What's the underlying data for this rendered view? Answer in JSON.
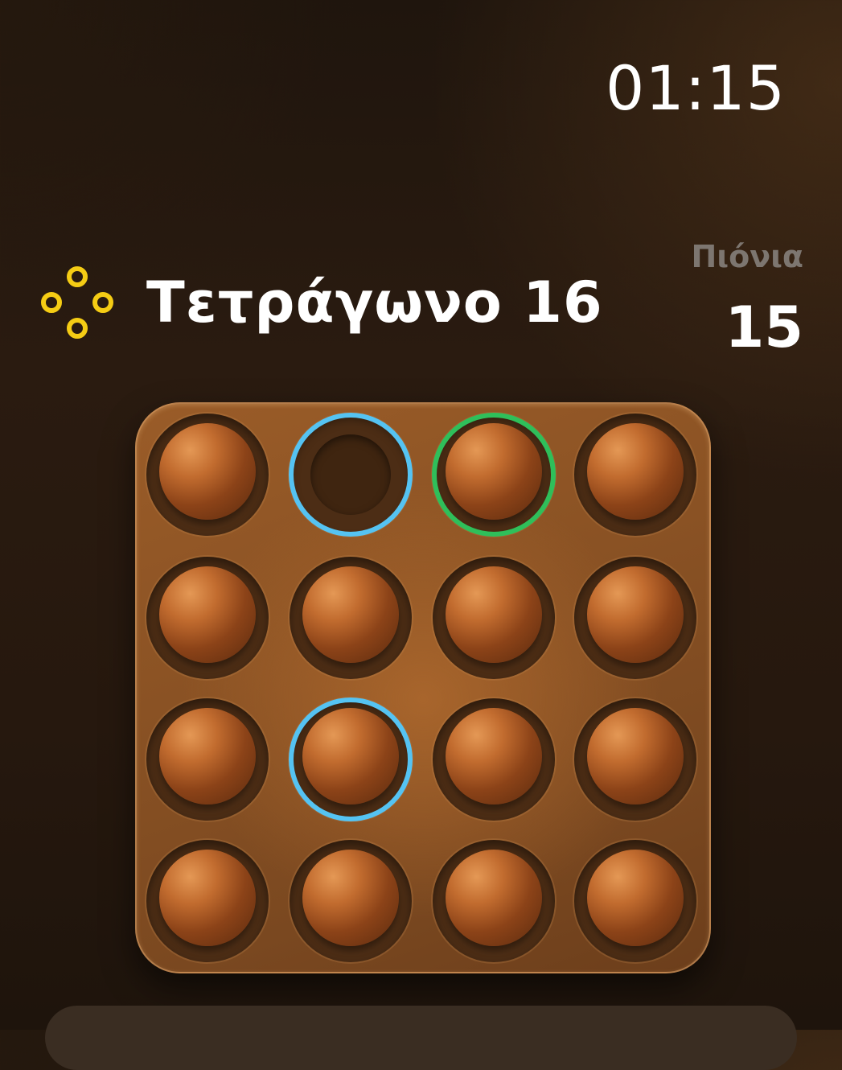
{
  "status": {
    "time": "01:15"
  },
  "header": {
    "icon": "four-rings-icon",
    "title": "Τετράγωνο 16",
    "accent_color": "#f5cc14"
  },
  "counter": {
    "label": "Πιόνια",
    "value": "15"
  },
  "board": {
    "rows": 4,
    "cols": 4,
    "cells": [
      [
        {
          "peg": true
        },
        {
          "peg": false,
          "highlight": "blue"
        },
        {
          "peg": true,
          "highlight": "green"
        },
        {
          "peg": true
        }
      ],
      [
        {
          "peg": true
        },
        {
          "peg": true
        },
        {
          "peg": true
        },
        {
          "peg": true
        }
      ],
      [
        {
          "peg": true
        },
        {
          "peg": true,
          "highlight": "blue"
        },
        {
          "peg": true
        },
        {
          "peg": true
        }
      ],
      [
        {
          "peg": true
        },
        {
          "peg": true
        },
        {
          "peg": true
        },
        {
          "peg": true
        }
      ]
    ],
    "highlight_colors": {
      "blue": "#55c3f2",
      "green": "#2fbf5a"
    }
  }
}
